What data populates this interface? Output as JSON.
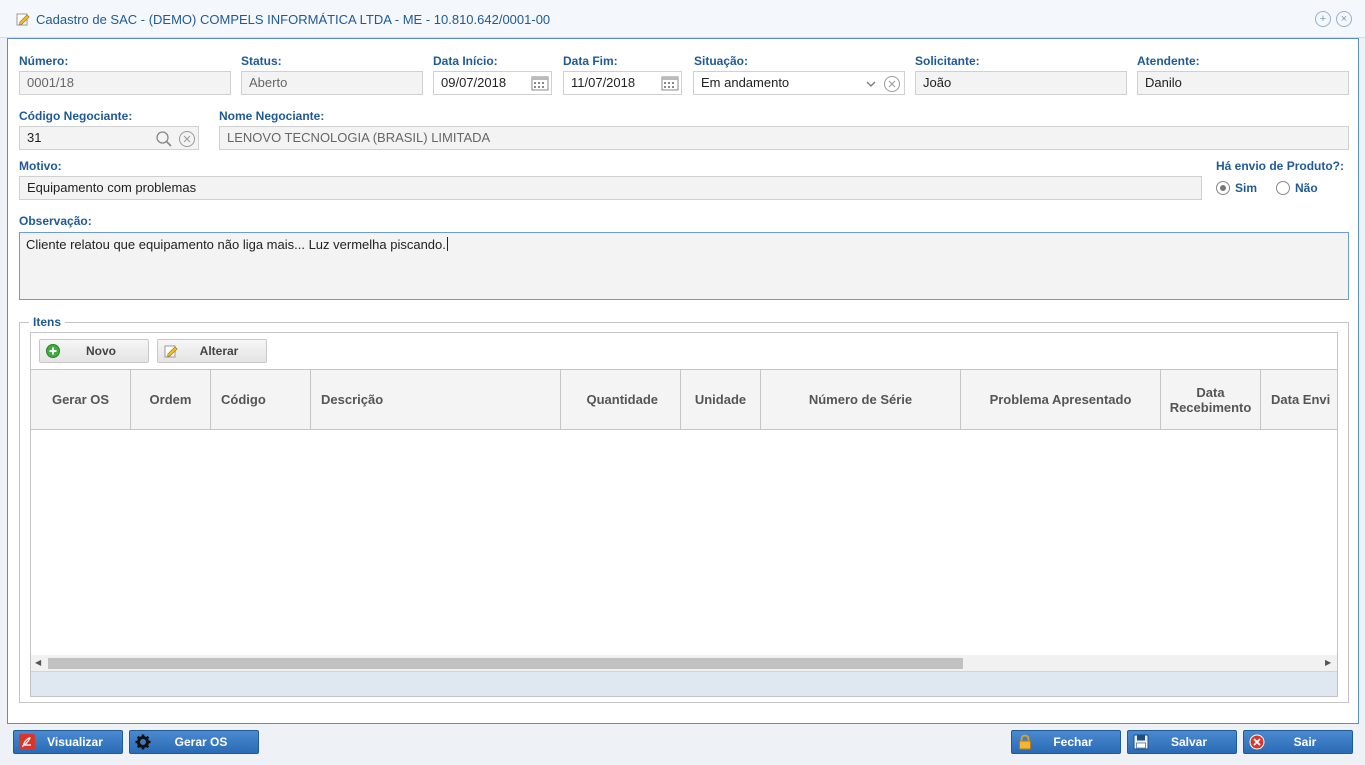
{
  "window": {
    "title": "Cadastro de SAC - (DEMO) COMPELS INFORMÁTICA LTDA - ME - 10.810.642/0001-00"
  },
  "form": {
    "numero": {
      "label": "Número:",
      "value": "0001/18"
    },
    "status": {
      "label": "Status:",
      "value": "Aberto"
    },
    "data_inicio": {
      "label": "Data Início:",
      "value": "09/07/2018"
    },
    "data_fim": {
      "label": "Data Fim:",
      "value": "11/07/2018"
    },
    "situacao": {
      "label": "Situação:",
      "value": "Em andamento"
    },
    "solicitante": {
      "label": "Solicitante:",
      "value": "João"
    },
    "atendente": {
      "label": "Atendente:",
      "value": "Danilo"
    },
    "codigo_negociante": {
      "label": "Código Negociante:",
      "value": "31"
    },
    "nome_negociante": {
      "label": "Nome Negociante:",
      "value": "LENOVO TECNOLOGIA (BRASIL) LIMITADA"
    },
    "motivo": {
      "label": "Motivo:",
      "value": "Equipamento com problemas"
    },
    "envio_produto": {
      "label": "Há envio de Produto?:",
      "options": [
        "Sim",
        "Não"
      ],
      "selected": "Sim"
    },
    "observacao": {
      "label": "Observação:",
      "value": "Cliente relatou que equipamento não liga mais... Luz vermelha piscando."
    }
  },
  "itens": {
    "legend": "Itens",
    "toolbar": {
      "novo": "Novo",
      "alterar": "Alterar"
    },
    "columns": [
      "Gerar OS",
      "Ordem",
      "Código",
      "Descrição",
      "Quantidade",
      "Unidade",
      "Número de Série",
      "Problema Apresentado",
      "Data Recebimento",
      "Data Envi"
    ],
    "rows": []
  },
  "footer": {
    "visualizar": "Visualizar",
    "gerar_os": "Gerar OS",
    "fechar": "Fechar",
    "salvar": "Salvar",
    "sair": "Sair"
  },
  "colors": {
    "accent": "#1f5a96",
    "button": "#2a6bb5",
    "border": "#5a8fc4"
  }
}
